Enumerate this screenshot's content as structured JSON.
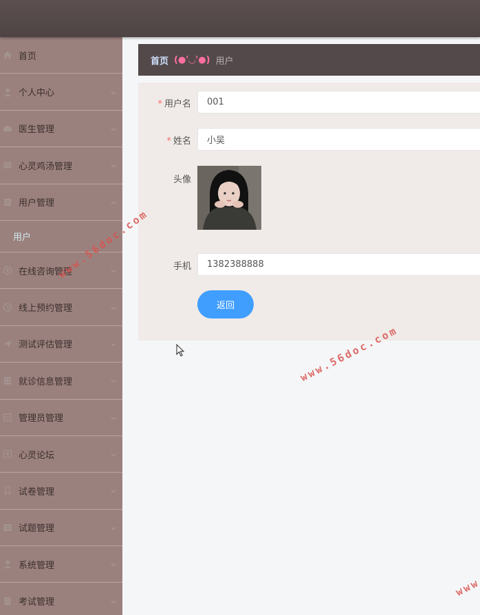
{
  "sidebar": {
    "items": [
      {
        "label": "首页",
        "icon": "home-icon",
        "expandable": false
      },
      {
        "label": "个人中心",
        "icon": "user-icon",
        "expandable": true
      },
      {
        "label": "医生管理",
        "icon": "doctor-icon",
        "expandable": true
      },
      {
        "label": "心灵鸡汤管理",
        "icon": "book-icon",
        "expandable": true
      },
      {
        "label": "用户管理",
        "icon": "users-icon",
        "expandable": true,
        "expanded": true,
        "children": [
          {
            "label": "用户"
          }
        ]
      },
      {
        "label": "在线咨询管理",
        "icon": "chat-icon",
        "expandable": true
      },
      {
        "label": "线上预约管理",
        "icon": "clock-icon",
        "expandable": true
      },
      {
        "label": "测试评估管理",
        "icon": "send-icon",
        "expandable": true
      },
      {
        "label": "就诊信息管理",
        "icon": "building-icon",
        "expandable": true
      },
      {
        "label": "管理员管理",
        "icon": "list-icon",
        "expandable": true
      },
      {
        "label": "心灵论坛",
        "icon": "forum-icon",
        "expandable": true
      },
      {
        "label": "试卷管理",
        "icon": "paper-icon",
        "expandable": true
      },
      {
        "label": "试题管理",
        "icon": "question-icon",
        "expandable": true
      },
      {
        "label": "系统管理",
        "icon": "person-icon",
        "expandable": true
      },
      {
        "label": "考试管理",
        "icon": "exam-icon",
        "expandable": true
      }
    ]
  },
  "breadcrumb": {
    "home": "首页",
    "separator": "(●'◡'●)",
    "current": "用户"
  },
  "form": {
    "username_label": "用户名",
    "username_value": "001",
    "name_label": "姓名",
    "name_value": "小吴",
    "avatar_label": "头像",
    "phone_label": "手机",
    "phone_value": "1382388888",
    "back_label": "返回"
  },
  "watermarks": [
    "www.56doc.com",
    "www.56doc.com",
    "www"
  ],
  "colors": {
    "topbar": "#4e4443",
    "sidebar": "#9b817d",
    "sidebar_active_sub": "#cfeaf0",
    "breadcrumb_bg": "#54494a",
    "form_bg": "#f0ebe8",
    "primary_button": "#409eff",
    "required": "#f56c6c"
  }
}
